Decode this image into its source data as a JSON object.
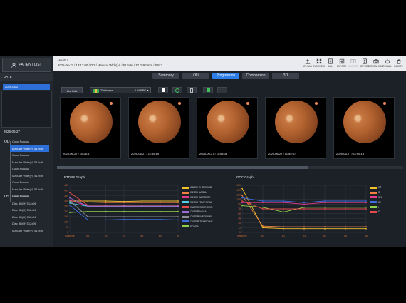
{
  "left_panel": {
    "patient_list_label": "PATIENT LIST",
    "date_header": "DATE",
    "selected_date": "2025-06-27",
    "scan_date": "2025-06-27",
    "od_label": "OD",
    "os_label": "OS",
    "od_scans": [
      "Color Fundus",
      "Macular Wide(H) 512x96",
      "Color Fundus",
      "Macular Wide(H) 512x96",
      "Color Fundus",
      "Macular Wide(H) 512x96",
      "Color Fundus",
      "Macular Wide(H) 512x96",
      "Color Fundus"
    ],
    "os_scans": [
      "Color Fundus",
      "Disc 3D(H) 512x96",
      "Disc 3D(H) 512x96",
      "Disc 3D(H) 512x96",
      "Disc 3D(H) 512x96",
      "Macular Wide(H) 512x96"
    ]
  },
  "topbar": {
    "patient_line": "Huvitz /",
    "scan_line": "2025-06-27 / 13:13:00 / OD / Macular Wide(H) / 512x96 / 12.0x9.0mm / SSI:7",
    "tools": [
      {
        "label": "UPLOAD",
        "icon": "upload-icon",
        "enabled": true
      },
      {
        "label": "OVERVIEW",
        "icon": "grid-icon",
        "enabled": true
      },
      {
        "label": "SAIL",
        "icon": "document-icon",
        "enabled": true
      },
      {
        "label": "EXPORT",
        "icon": "export-icon",
        "enabled": true
      },
      {
        "label": "COMPARE",
        "icon": "compare-icon",
        "enabled": false
      },
      {
        "label": "REPORT",
        "icon": "report-icon",
        "enabled": true
      },
      {
        "label": "SCREEN DUMP",
        "icon": "camera-icon",
        "enabled": true
      },
      {
        "label": "RECALL",
        "icon": "power-icon",
        "enabled": true
      },
      {
        "label": "DELETE",
        "icon": "trash-icon",
        "enabled": true
      }
    ]
  },
  "tabs": [
    {
      "label": "Summary",
      "active": false
    },
    {
      "label": "OU",
      "active": false
    },
    {
      "label": "Progression",
      "active": true
    },
    {
      "label": "Comparison",
      "active": false
    },
    {
      "label": "3D",
      "active": false
    }
  ],
  "toolbar": {
    "list_edit_label": "List Edit",
    "map_select": "Thickness",
    "layer_select": "ILM-RPE"
  },
  "images": [
    {
      "timestamp": "2025-06-27 / 10:26:47"
    },
    {
      "timestamp": "2025-06-27 / 11:55:19"
    },
    {
      "timestamp": "2025-06-27 / 11:55:38"
    },
    {
      "timestamp": "2025-06-27 / 11:55:57"
    },
    {
      "timestamp": "2025-06-27 / 11:56:13"
    }
  ],
  "colors": {
    "accent": "#2d7ee8",
    "axis": "#c86b38"
  },
  "chart_data": [
    {
      "type": "line",
      "title": "ETDRS Graph",
      "x": [
        "Baseline",
        "#1",
        "#2",
        "#3",
        "#4",
        "#5",
        "#6"
      ],
      "y_ticks": [
        "450",
        "400",
        "350",
        "300",
        "250",
        "200",
        "150",
        "100",
        "50",
        "0"
      ],
      "ylim": [
        0,
        450
      ],
      "series": [
        {
          "name": "INNER SUPERIOR",
          "color": "#f2c12e",
          "values": [
            300,
            300,
            300,
            295,
            300,
            300,
            300
          ]
        },
        {
          "name": "INNER NASAL",
          "color": "#f0803c",
          "values": [
            290,
            290,
            285,
            285,
            285,
            285,
            285
          ]
        },
        {
          "name": "INNER INFERIOR",
          "color": "#e03c8a",
          "values": [
            310,
            250,
            250,
            250,
            250,
            250,
            250
          ]
        },
        {
          "name": "INNER TEMPORAL",
          "color": "#4fd0e6",
          "values": [
            280,
            250,
            250,
            250,
            250,
            250,
            250
          ]
        },
        {
          "name": "OUTER SUPERIOR",
          "color": "#e54b4b",
          "values": [
            380,
            260,
            260,
            260,
            260,
            260,
            260
          ]
        },
        {
          "name": "OUTER NASAL",
          "color": "#9c6cd9",
          "values": [
            330,
            250,
            250,
            250,
            250,
            250,
            250
          ]
        },
        {
          "name": "OUTER INFERIOR",
          "color": "#8a8f97",
          "values": [
            300,
            150,
            150,
            150,
            150,
            150,
            150
          ]
        },
        {
          "name": "OUTER TEMPORAL",
          "color": "#3b6fe0",
          "values": [
            260,
            120,
            120,
            125,
            125,
            125,
            120
          ]
        },
        {
          "name": "FOVEA",
          "color": "#8fd24a",
          "values": [
            190,
            200,
            200,
            200,
            200,
            200,
            200
          ]
        }
      ]
    },
    {
      "type": "line",
      "title": "GCC Graph",
      "x": [
        "Baseline",
        "#1",
        "#2",
        "#3",
        "#4",
        "#5",
        "#6"
      ],
      "y_ticks": [
        "150",
        "135",
        "120",
        "105",
        "90",
        "75",
        "60",
        "45",
        "30",
        "15",
        "0"
      ],
      "ylim": [
        0,
        150
      ],
      "series": [
        {
          "name": "ST",
          "color": "#f2c12e",
          "values": [
            140,
            15,
            12,
            12,
            12,
            12,
            12
          ]
        },
        {
          "name": "S",
          "color": "#f0803c",
          "values": [
            118,
            20,
            18,
            18,
            18,
            18,
            18
          ]
        },
        {
          "name": "SN",
          "color": "#e03c8a",
          "values": [
            95,
            95,
            95,
            90,
            95,
            95,
            95
          ]
        },
        {
          "name": "IN",
          "color": "#3b6fe0",
          "values": [
            110,
            100,
            100,
            95,
            100,
            100,
            100
          ]
        },
        {
          "name": "I",
          "color": "#8fd24a",
          "values": [
            85,
            80,
            65,
            80,
            80,
            80,
            80
          ]
        },
        {
          "name": "IT",
          "color": "#e54b4b",
          "values": [
            100,
            75,
            75,
            75,
            75,
            75,
            75
          ]
        }
      ]
    }
  ]
}
